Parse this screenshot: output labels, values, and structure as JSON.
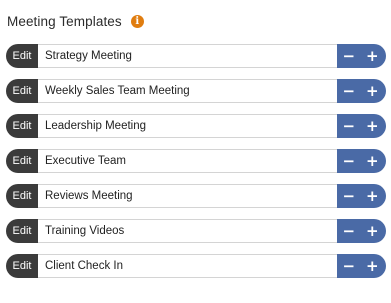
{
  "header": {
    "title": "Meeting Templates",
    "info_icon_glyph": "i"
  },
  "templates": [
    {
      "edit_label": "Edit",
      "name": "Strategy Meeting"
    },
    {
      "edit_label": "Edit",
      "name": "Weekly Sales Team Meeting"
    },
    {
      "edit_label": "Edit",
      "name": "Leadership Meeting"
    },
    {
      "edit_label": "Edit",
      "name": "Executive Team"
    },
    {
      "edit_label": "Edit",
      "name": "Reviews Meeting"
    },
    {
      "edit_label": "Edit",
      "name": "Training Videos"
    },
    {
      "edit_label": "Edit",
      "name": "Client Check In"
    }
  ],
  "controls": {
    "minus_glyph": "−",
    "plus_glyph": "+"
  },
  "colors": {
    "edit_bg": "#3b3b3b",
    "control_bg": "#4a6aa6",
    "info_icon": "#e07d10"
  },
  "icons": {
    "info": "info-icon",
    "minus": "minus-icon",
    "plus": "plus-icon"
  }
}
